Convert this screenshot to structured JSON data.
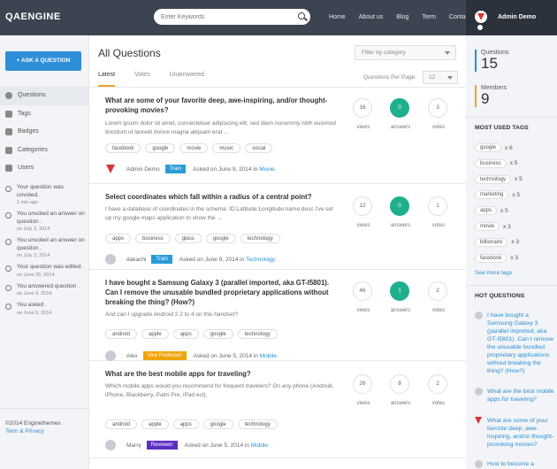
{
  "header": {
    "logo": "QAENGINE",
    "search_placeholder": "Enter Keywords",
    "nav": [
      "Home",
      "About us",
      "Blog",
      "Term",
      "Contact"
    ],
    "user_name": "Admin Demo"
  },
  "sidebar": {
    "ask_button": "ASK A QUESTION",
    "items": [
      {
        "label": "Questions",
        "icon": "question-circle-icon"
      },
      {
        "label": "Tags",
        "icon": "tag-icon"
      },
      {
        "label": "Badges",
        "icon": "badge-icon"
      },
      {
        "label": "Categories",
        "icon": "categories-icon"
      },
      {
        "label": "Users",
        "icon": "users-icon"
      }
    ],
    "activity": [
      {
        "text": "Your question was unvoted.",
        "time": "1 min ago",
        "icon": "undo-icon"
      },
      {
        "text": "You unvoted an answer on question .",
        "time": "on July 3, 2014",
        "icon": "undo-icon"
      },
      {
        "text": "You unvoted an answer on question .",
        "time": "on July 3, 2014",
        "icon": "undo-icon"
      },
      {
        "text": "Your question was edited.",
        "time": "on June 25, 2014",
        "icon": "question-circle-icon"
      },
      {
        "text": "You answered question .",
        "time": "on June 9, 2014",
        "icon": "comments-icon"
      },
      {
        "text": "You asked .",
        "time": "on June 5, 2014",
        "icon": "question-circle-icon"
      }
    ],
    "copyright": "©2014 Enginethemes",
    "terms": "Term & Privacy"
  },
  "main": {
    "title": "All Questions",
    "category_filter": "Filter by category",
    "tabs": [
      "Latest",
      "Votes",
      "Unanswered"
    ],
    "qpp_label": "Questions Per Page:",
    "qpp_value": "12",
    "questions": [
      {
        "title": "What are some of your favorite deep, awe-inspiring, and/or thought-provoking movies?",
        "excerpt": "Lorem ipsum dolor sit amet, consectetuer adipiscing elit, sed diam nonummy nibh euismod tincidunt ut laoreet dolore magna aliquam erat ...",
        "tags": [
          "facebook",
          "google",
          "movie",
          "music",
          "social"
        ],
        "author": "Admin Demo",
        "badge": "Train",
        "badge_color": "#2a9bd6",
        "asked": "Asked on June 9, 2014 in",
        "category": "Movie.",
        "views": "16",
        "answers": "0",
        "votes": "3",
        "answers_highlight": true
      },
      {
        "title": "Select coordinates which fall within a radius of a central point?",
        "excerpt": "I have a database of coordinates in the schema: ID:Latitude:Longitude:name:desc I've set up my google maps application to show the ...",
        "tags": [
          "apps",
          "business",
          "glass",
          "google",
          "technology"
        ],
        "author": "dakachi",
        "badge": "Train",
        "badge_color": "#2a9bd6",
        "asked": "Asked on June 9, 2014 in",
        "category": "Technology.",
        "views": "12",
        "answers": "0",
        "votes": "1",
        "answers_highlight": true
      },
      {
        "title": "I have bought a Samsung Galaxy 3 (parallel imported, aka GT-I5801). Can I remove the unusable bundled proprietary applications without breaking the thing? (How?)",
        "excerpt": "And can I upgrade Android 2.2 to 4 on this handset?",
        "tags": [
          "android",
          "apple",
          "apps",
          "google",
          "technology"
        ],
        "author": "Alex",
        "badge": "Vice Professor",
        "badge_color": "#f0a30a",
        "asked": "Asked on June 5, 2014 in",
        "category": "Mobile.",
        "views": "46",
        "answers": "1",
        "votes": "2",
        "answers_highlight": true
      },
      {
        "title": "What are the best mobile apps for traveling?",
        "excerpt": "Which mobile apps would you recommend for frequent travelers? On any phone (Android, iPhone, Blackberry, Palm Pre, iPad ect).",
        "tags": [
          "android",
          "apple",
          "apps",
          "google",
          "technology"
        ],
        "author": "Marry",
        "badge": "Reviewer",
        "badge_color": "#5b2fc4",
        "asked": "Asked on June 5, 2014 in",
        "category": "Mobile.",
        "views": "28",
        "answers": "8",
        "votes": "2",
        "answers_highlight": false
      }
    ],
    "labels": {
      "views": "views",
      "answers": "answers",
      "votes": "votes"
    }
  },
  "right": {
    "questions_label": "Questions",
    "questions_count": "15",
    "members_label": "Members",
    "members_count": "9",
    "tags_title": "MOST USED TAGS",
    "tags": [
      {
        "name": "google",
        "count": "x 6"
      },
      {
        "name": "business",
        "count": "x 5"
      },
      {
        "name": "technology",
        "count": "x 5"
      },
      {
        "name": "marketing",
        "count": "x 5"
      },
      {
        "name": "apps",
        "count": "x 5"
      },
      {
        "name": "movie",
        "count": "x 3"
      },
      {
        "name": "billionaire",
        "count": "x 3"
      },
      {
        "name": "facebook",
        "count": "x 3"
      }
    ],
    "see_more": "See more tags",
    "hot_title": "HOT QUESTIONS",
    "hot": [
      "I have bought a Samsung Galaxy 3 (parallel imported, aka GT-I5801). Can I remove the unusable bundled proprietary applications without breaking the thing? (How?)",
      "What are the best mobile apps for traveling?",
      "What are some of your favorite deep, awe-inspiring, and/or thought-provoking movies?",
      "How to become a"
    ]
  },
  "colors": {
    "accent": "#2e8ed8",
    "header": "#3d4451",
    "answered": "#1eaf8e",
    "tab_underline": "#e9a52a"
  }
}
